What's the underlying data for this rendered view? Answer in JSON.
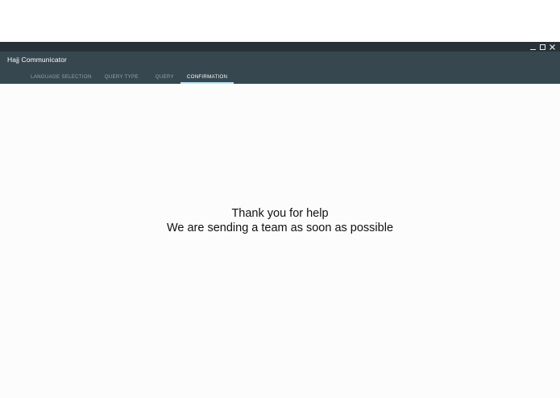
{
  "window": {
    "title": "Hajj Communicator",
    "controls": {
      "minimize_icon": "minimize-icon",
      "maximize_icon": "maximize-icon",
      "close_icon": "close-icon"
    }
  },
  "tabs": [
    {
      "label": "LANGUAGE SELECTION",
      "active": false
    },
    {
      "label": "QUERY TYPE",
      "active": false
    },
    {
      "label": "QUERY",
      "active": false
    },
    {
      "label": "CONFIRMATION",
      "active": true
    }
  ],
  "content": {
    "line1": "Thank you for help",
    "line2": "We are sending a team as soon as possible"
  },
  "colors": {
    "titlebar": "#263238",
    "appbar": "#37474f",
    "active_indicator": "#b3e5fc",
    "inactive_tab_text": "#90a4ae"
  }
}
